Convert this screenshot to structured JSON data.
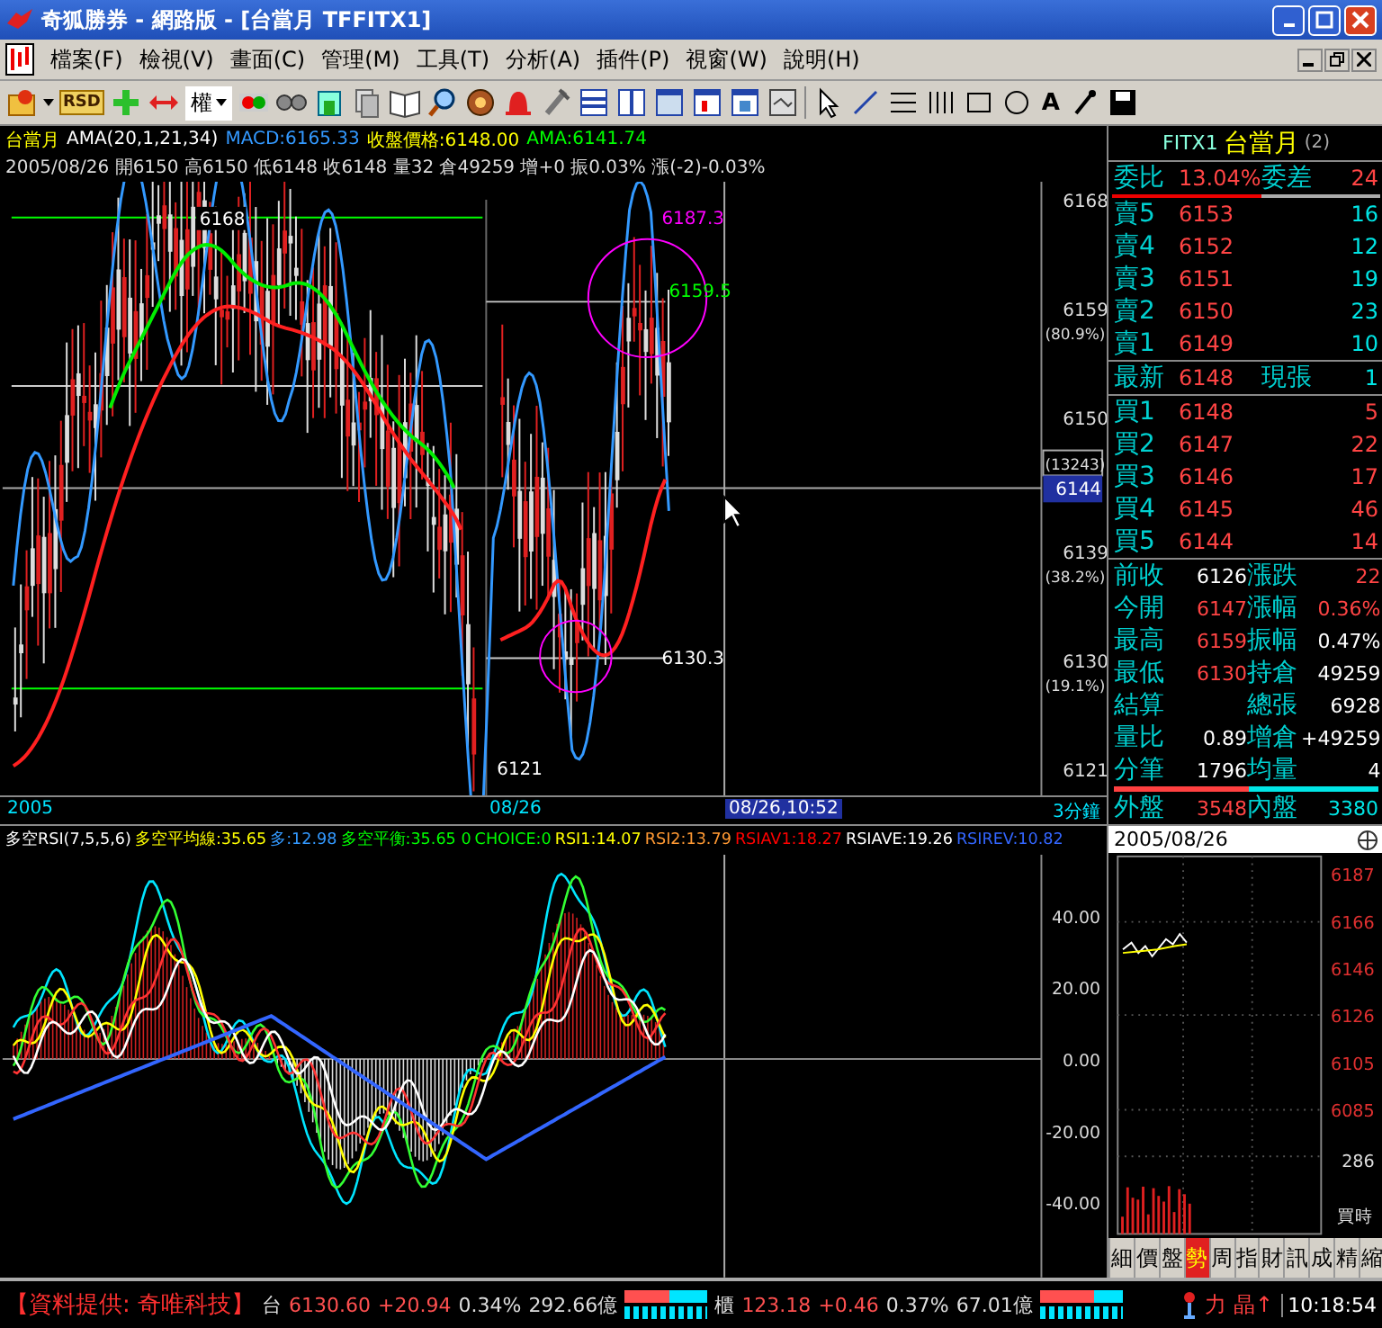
{
  "window": {
    "title": "奇狐勝券 - 網路版 - [台當月 TFFITX1]"
  },
  "menu": [
    "檔案(F)",
    "檢視(V)",
    "畫面(C)",
    "管理(M)",
    "工具(T)",
    "分析(A)",
    "插件(P)",
    "視窗(W)",
    "說明(H)"
  ],
  "toolbar": {
    "badge": "RSD",
    "dropdown": "權",
    "text_tool": "A"
  },
  "chart": {
    "legend": [
      {
        "text": "台當月",
        "color": "#ffff00"
      },
      {
        "text": "AMA(20,1,21,34)",
        "color": "#ffffff"
      },
      {
        "text": "MACD:6165.33",
        "color": "#3399ff"
      },
      {
        "text": "收盤價格:6148.00",
        "color": "#ffff00"
      },
      {
        "text": "AMA:6141.74",
        "color": "#00ff00"
      }
    ],
    "info": "2005/08/26 開6150 高6150 低6148 收6148 量32 倉49259 增+0 振0.03% 漲(-2)-0.03%",
    "price_axis": [
      {
        "label": "6168"
      },
      {
        "label": "6159",
        "sub": "(80.9%)"
      },
      {
        "label": "6150"
      },
      {
        "label": "6139",
        "sub": "(38.2%)"
      },
      {
        "label": "6130",
        "sub": "(19.1%)"
      },
      {
        "label": "6121"
      }
    ],
    "cursor": {
      "volume": "(13243)",
      "price": "6144"
    },
    "annotations": [
      {
        "label": "6168",
        "color": "#ffffff"
      },
      {
        "label": "6187.3",
        "color": "#ff00ff"
      },
      {
        "label": "6159.5",
        "color": "#00ff00"
      },
      {
        "label": "6130.3",
        "color": "#ffffff"
      },
      {
        "label": "6121",
        "color": "#ffffff"
      }
    ],
    "time_axis": [
      "2005",
      "08/26"
    ],
    "cursor_time": "08/26,10:52",
    "period": "3分鐘"
  },
  "indicator": {
    "legend": [
      {
        "text": "多空RSI(7,5,5,6)",
        "color": "#ffffff"
      },
      {
        "text": "多空平均線:35.65",
        "color": "#ffff00"
      },
      {
        "text": "多:12.98",
        "color": "#3399ff"
      },
      {
        "text": "多空平衡:35.65 0",
        "color": "#00ff00"
      },
      {
        "text": "CHOICE:0",
        "color": "#00ff00"
      },
      {
        "text": "RSI1:14.07",
        "color": "#ffff00"
      },
      {
        "text": "RSI2:13.79",
        "color": "#ff9933"
      },
      {
        "text": "RSIAV1:18.27",
        "color": "#ff0000"
      },
      {
        "text": "RSIAVE:19.26",
        "color": "#ffffff"
      },
      {
        "text": "RSIREV:10.82",
        "color": "#3366ff"
      }
    ],
    "axis": [
      "40.00",
      "20.00",
      "0.00",
      "-20.00",
      "-40.00"
    ]
  },
  "quote": {
    "symbol": "FITX1",
    "name": "台當月",
    "count": "(2)",
    "ratio_label": "委比",
    "ratio": "13.04%",
    "diff_label": "委差",
    "diff": "24",
    "ratio_bar": {
      "level": 0.56
    },
    "asks": [
      {
        "label": "賣5",
        "price": "6153",
        "volume": "16"
      },
      {
        "label": "賣4",
        "price": "6152",
        "volume": "12"
      },
      {
        "label": "賣3",
        "price": "6151",
        "volume": "19"
      },
      {
        "label": "賣2",
        "price": "6150",
        "volume": "23"
      },
      {
        "label": "賣1",
        "price": "6149",
        "volume": "10"
      }
    ],
    "last": {
      "label": "最新",
      "price": "6148",
      "label2": "現張",
      "volume": "1"
    },
    "bids": [
      {
        "label": "買1",
        "price": "6148",
        "volume": "5"
      },
      {
        "label": "買2",
        "price": "6147",
        "volume": "22"
      },
      {
        "label": "買3",
        "price": "6146",
        "volume": "17"
      },
      {
        "label": "買4",
        "price": "6145",
        "volume": "46"
      },
      {
        "label": "買5",
        "price": "6144",
        "volume": "14"
      }
    ],
    "stats": [
      {
        "label": "前收",
        "value": "6126",
        "color": "#ffffff"
      },
      {
        "label": "漲跌",
        "value": "22",
        "color": "#ff4444"
      },
      {
        "label": "今開",
        "value": "6147",
        "color": "#ff4444"
      },
      {
        "label": "漲幅",
        "value": "0.36%",
        "color": "#ff4444"
      },
      {
        "label": "最高",
        "value": "6159",
        "color": "#ff4444"
      },
      {
        "label": "振幅",
        "value": "0.47%",
        "color": "#ffffff"
      },
      {
        "label": "最低",
        "value": "6130",
        "color": "#ff4444"
      },
      {
        "label": "持倉",
        "value": "49259",
        "color": "#ffffff"
      },
      {
        "label": "結算"
      },
      {
        "label": "總張",
        "value": "6928",
        "color": "#ffffff"
      },
      {
        "label": "量比",
        "value": "0.89",
        "color": "#ffffff"
      },
      {
        "label": "增倉",
        "value": "+49259",
        "color": "#ffffff"
      },
      {
        "label": "分筆",
        "value": "1796",
        "color": "#ffffff"
      },
      {
        "label": "均量",
        "value": "4",
        "color": "#ffffff"
      }
    ],
    "outer_label": "外盤",
    "outer": "3548",
    "inner_label": "內盤",
    "inner": "3380",
    "outer_bar": {
      "level": 0.51
    }
  },
  "mini_chart": {
    "date": "2005/08/26",
    "axis": [
      "6187",
      "6166",
      "6146",
      "6126",
      "6105",
      "6085"
    ],
    "volume": "286",
    "note": "買時"
  },
  "tabs": [
    {
      "label": "細",
      "selected": false
    },
    {
      "label": "價",
      "selected": false
    },
    {
      "label": "盤",
      "selected": false
    },
    {
      "label": "勢",
      "selected": true
    },
    {
      "label": "周",
      "selected": false
    },
    {
      "label": "指",
      "selected": false
    },
    {
      "label": "財",
      "selected": false
    },
    {
      "label": "訊",
      "selected": false
    },
    {
      "label": "成",
      "selected": false
    },
    {
      "label": "精",
      "selected": false
    },
    {
      "label": "縮",
      "selected": false
    }
  ],
  "status": {
    "provider": "【資料提供: 奇唯科技】",
    "indices": [
      {
        "name": "台",
        "value": "6130.60",
        "change": "+20.94",
        "percent": "0.34%",
        "amount": "292.66億",
        "level": 0.55
      },
      {
        "name": "櫃",
        "value": "123.18",
        "change": "+0.46",
        "percent": "0.37%",
        "amount": "67.01億",
        "level": 0.65
      }
    ],
    "tray": [
      "力",
      "晶↑"
    ],
    "time": "10:18:54"
  }
}
